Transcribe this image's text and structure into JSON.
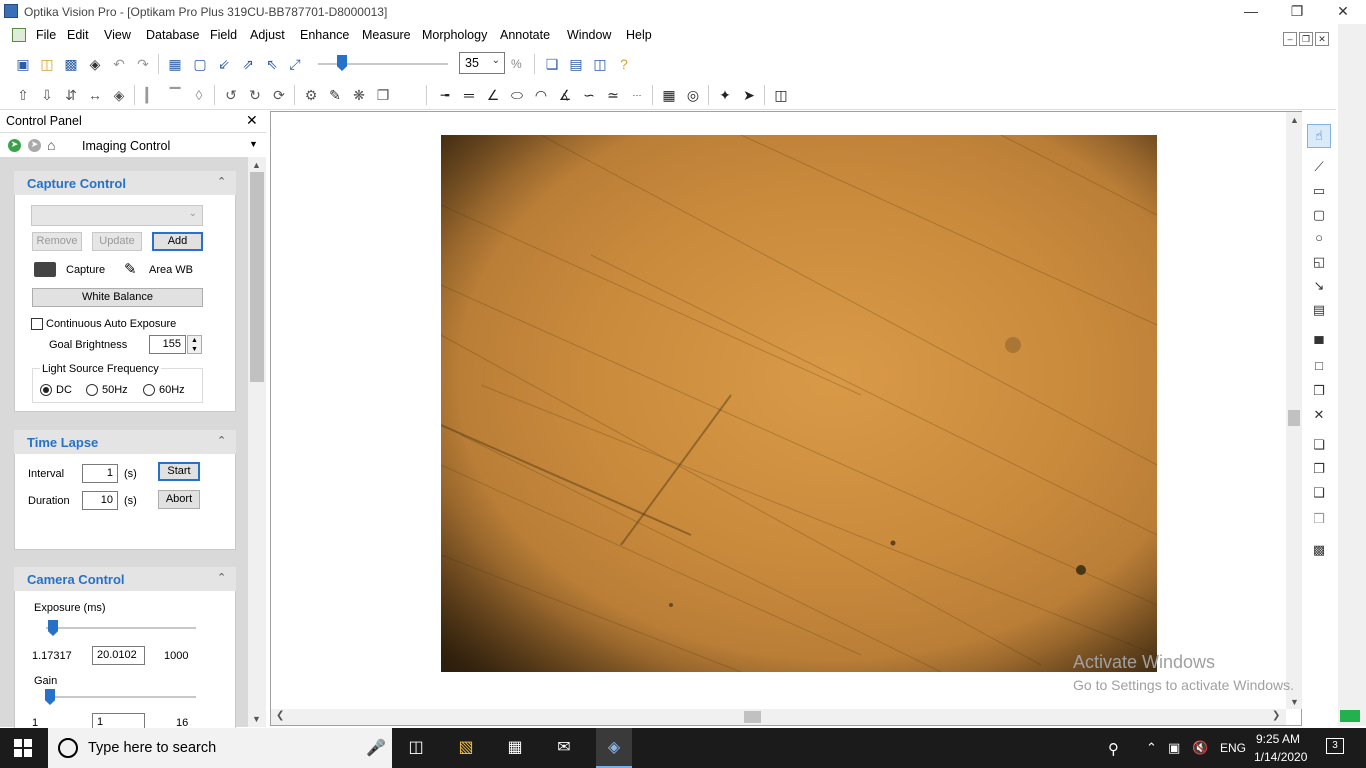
{
  "window": {
    "title": "Optika Vision Pro - [Optikam Pro Plus 319CU-BB787701-D8000013]"
  },
  "menu": [
    "File",
    "Edit",
    "View",
    "Database",
    "Field",
    "Adjust",
    "Enhance",
    "Measure",
    "Morphology",
    "Annotate",
    "Window",
    "Help"
  ],
  "toolbar": {
    "zoom_value": "35",
    "zoom_unit": "%"
  },
  "control_panel": {
    "title": "Control Panel",
    "nav_label": "Imaging Control"
  },
  "capture_control": {
    "title": "Capture Control",
    "remove_label": "Remove",
    "update_label": "Update",
    "add_label": "Add",
    "capture_label": "Capture",
    "area_wb_label": "Area WB",
    "white_balance_label": "White Balance",
    "continuous_auto_exposure_label": "Continuous Auto Exposure",
    "goal_brightness_label": "Goal Brightness",
    "goal_brightness_value": "155",
    "light_source_label": "Light Source Frequency",
    "freq_options": [
      "DC",
      "50Hz",
      "60Hz"
    ],
    "freq_selected": "DC"
  },
  "time_lapse": {
    "title": "Time Lapse",
    "interval_label": "Interval",
    "interval_value": "1",
    "duration_label": "Duration",
    "duration_value": "10",
    "unit": "(s)",
    "start_label": "Start",
    "abort_label": "Abort"
  },
  "camera_control": {
    "title": "Camera Control",
    "exposure_label": "Exposure (ms)",
    "exposure_min": "1.17317",
    "exposure_value": "20.0102",
    "exposure_max": "1000",
    "gain_label": "Gain",
    "gain_min": "1",
    "gain_value": "1",
    "gain_max": "16"
  },
  "watermark": {
    "line1": "Activate Windows",
    "line2": "Go to Settings to activate Windows."
  },
  "taskbar": {
    "search_placeholder": "Type here to search",
    "language": "ENG",
    "time": "9:25 AM",
    "date": "1/14/2020",
    "notification_count": "3"
  },
  "colors": {
    "accent": "#2672c8",
    "panel_bg": "#d9d9d9",
    "taskbar_bg": "#1b1b1b"
  }
}
